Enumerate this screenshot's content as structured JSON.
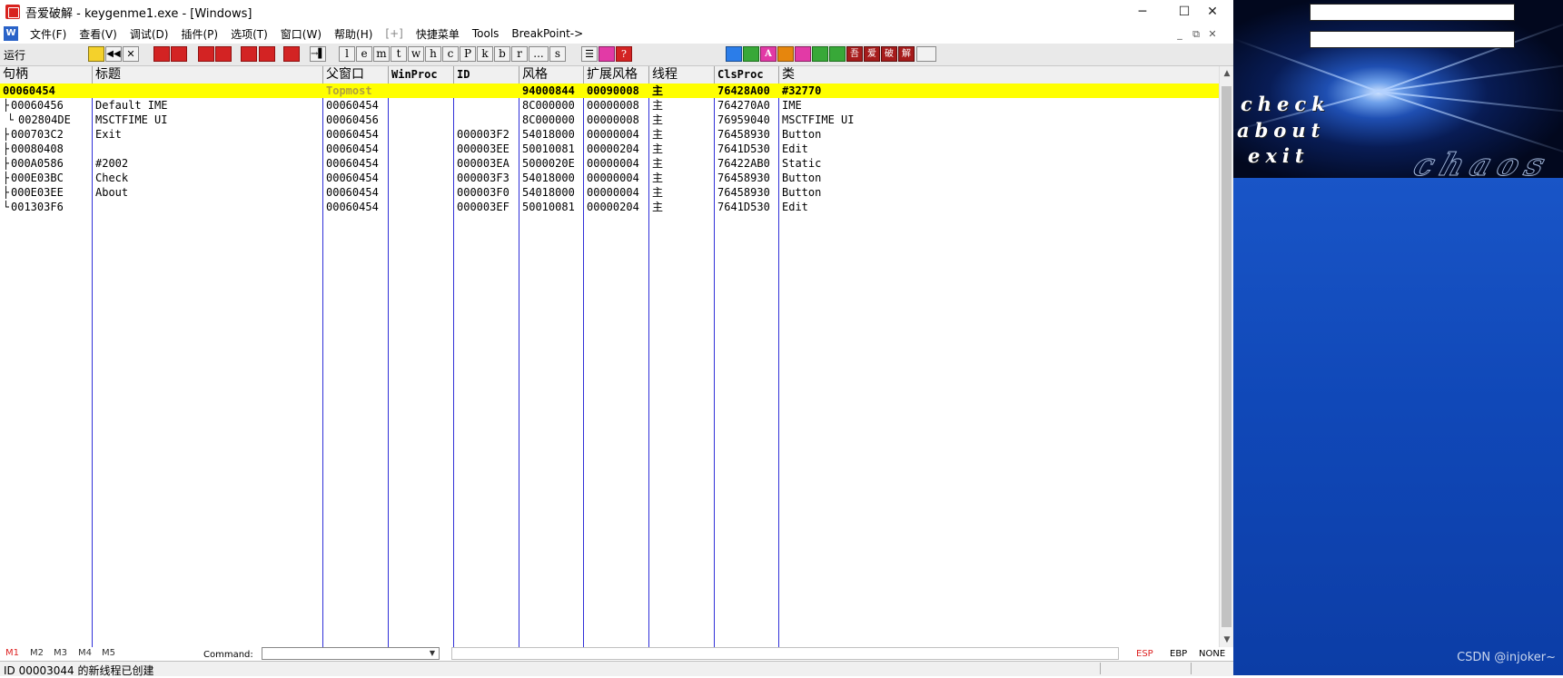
{
  "window": {
    "title": "吾爱破解 - keygenme1.exe - [Windows]",
    "controls": {
      "minimize": "─",
      "maximize": "☐",
      "close": "✕"
    }
  },
  "menu": {
    "items": [
      "文件(F)",
      "查看(V)",
      "调试(D)",
      "插件(P)",
      "选项(T)",
      "窗口(W)",
      "帮助(H)",
      "[+]",
      "快捷菜单",
      "Tools",
      "BreakPoint->"
    ],
    "mdi_controls": {
      "minimize": "_",
      "restore": "⧉",
      "close": "✕"
    }
  },
  "toolbar": {
    "status": "运行",
    "letter_buttons": [
      "l",
      "e",
      "m",
      "t",
      "w",
      "h",
      "c",
      "P",
      "k",
      "b",
      "r",
      "...",
      "s"
    ],
    "help": "?",
    "icon_labels": {
      "a": "A",
      "wu": "吾",
      "ai": "爱",
      "po": "破",
      "jie": "解"
    }
  },
  "table": {
    "headers": [
      "句柄",
      "标题",
      "父窗口",
      "WinProc",
      "ID",
      "风格",
      "扩展风格",
      "线程",
      "ClsProc",
      "类"
    ],
    "rows": [
      {
        "handle": "00060454",
        "title": "",
        "parent": "Topmost",
        "winproc": "",
        "id": "",
        "style": "94000844",
        "exstyle": "00090008",
        "thread": "主",
        "clsproc": "76428A00",
        "class": "#32770"
      },
      {
        "handle": "00060456",
        "title": "Default IME",
        "parent": "00060454",
        "winproc": "",
        "id": "",
        "style": "8C000000",
        "exstyle": "00000008",
        "thread": "主",
        "clsproc": "764270A0",
        "class": "IME"
      },
      {
        "handle": "002804DE",
        "title": "MSCTFIME UI",
        "parent": "00060456",
        "winproc": "",
        "id": "",
        "style": "8C000000",
        "exstyle": "00000008",
        "thread": "主",
        "clsproc": "76959040",
        "class": "MSCTFIME UI"
      },
      {
        "handle": "000703C2",
        "title": "Exit",
        "parent": "00060454",
        "winproc": "",
        "id": "000003F2",
        "style": "54018000",
        "exstyle": "00000004",
        "thread": "主",
        "clsproc": "76458930",
        "class": "Button"
      },
      {
        "handle": "00080408",
        "title": "",
        "parent": "00060454",
        "winproc": "",
        "id": "000003EE",
        "style": "50010081",
        "exstyle": "00000204",
        "thread": "主",
        "clsproc": "7641D530",
        "class": "Edit"
      },
      {
        "handle": "000A0586",
        "title": "#2002",
        "parent": "00060454",
        "winproc": "",
        "id": "000003EA",
        "style": "5000020E",
        "exstyle": "00000004",
        "thread": "主",
        "clsproc": "76422AB0",
        "class": "Static"
      },
      {
        "handle": "000E03BC",
        "title": "Check",
        "parent": "00060454",
        "winproc": "",
        "id": "000003F3",
        "style": "54018000",
        "exstyle": "00000004",
        "thread": "主",
        "clsproc": "76458930",
        "class": "Button"
      },
      {
        "handle": "000E03EE",
        "title": "About",
        "parent": "00060454",
        "winproc": "",
        "id": "000003F0",
        "style": "54018000",
        "exstyle": "00000004",
        "thread": "主",
        "clsproc": "76458930",
        "class": "Button"
      },
      {
        "handle": "001303F6",
        "title": "",
        "parent": "00060454",
        "winproc": "",
        "id": "000003EF",
        "style": "50010081",
        "exstyle": "00000204",
        "thread": "主",
        "clsproc": "7641D530",
        "class": "Edit"
      }
    ]
  },
  "command_bar": {
    "markers": [
      "M1",
      "M2",
      "M3",
      "M4",
      "M5"
    ],
    "command_label": "Command:",
    "command_value": "",
    "registers": [
      "ESP",
      "EBP",
      "NONE"
    ]
  },
  "status": {
    "text": "ID 00003044 的新线程已创建"
  },
  "keygenme": {
    "buttons": [
      "check",
      "about",
      "exit"
    ],
    "logo": "chaos",
    "watermark": "CSDN @injoker~"
  },
  "colors": {
    "selection": "#ffff00",
    "column_divider": "#3030d8",
    "active_marker": "#dd2222"
  }
}
